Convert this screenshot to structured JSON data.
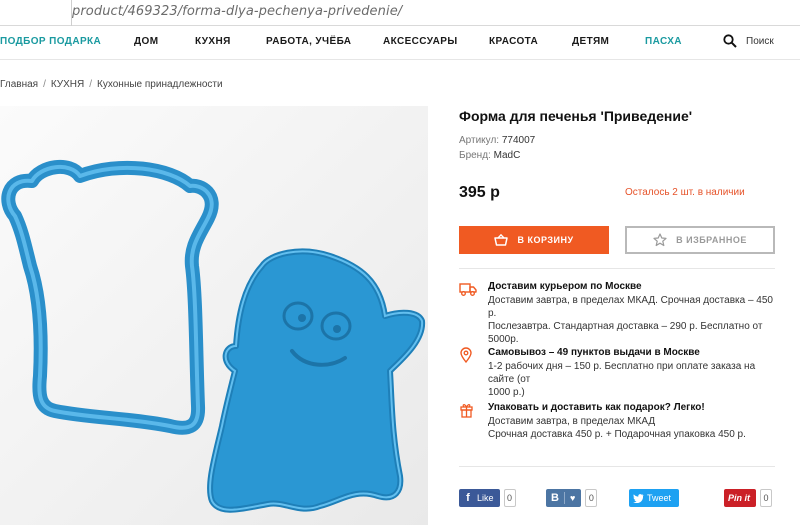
{
  "browser": {
    "url": "product/469323/forma-dlya-pechenya-privedenie/"
  },
  "nav": {
    "items": [
      {
        "label": "ПОДБОР ПОДАРКА",
        "accent": true
      },
      {
        "label": "ДОМ"
      },
      {
        "label": "КУХНЯ"
      },
      {
        "label": "РАБОТА, УЧЁБА"
      },
      {
        "label": "АКСЕССУАРЫ"
      },
      {
        "label": "КРАСОТА"
      },
      {
        "label": "ДЕТЯМ"
      },
      {
        "label": "ПАСХА",
        "accent": true
      }
    ],
    "search_label": "Поиск"
  },
  "breadcrumb": [
    "Главная",
    "КУХНЯ",
    "Кухонные принадлежности"
  ],
  "product": {
    "title": "Форма для печенья 'Приведение'",
    "article_label": "Артикул:",
    "article_value": "774007",
    "brand_label": "Бренд:",
    "brand_value": "MadC",
    "price": "395 р",
    "stock": "Осталось 2 шт. в наличии",
    "image_alt": "ghost and bread shaped blue cookie cutters"
  },
  "buttons": {
    "cart": "В КОРЗИНУ",
    "favorite": "В ИЗБРАННОЕ"
  },
  "delivery": [
    {
      "icon": "truck-icon",
      "title": "Доставим курьером по Москве",
      "lines": [
        "Доставим завтра, в пределах МКАД. Срочная доставка – 450 р.",
        "Послезавтра. Стандартная доставка – 290 р. Бесплатно от",
        "5000р."
      ]
    },
    {
      "icon": "location-pin-icon",
      "title": "Самовывоз – 49 пунктов выдачи в Москве",
      "lines": [
        "1-2 рабочих дня – 150 р. Бесплатно при оплате заказа на сайте (от",
        "1000 р.)"
      ]
    },
    {
      "icon": "gift-icon",
      "title": "Упаковать и доставить как подарок? Легко!",
      "lines": [
        "Доставим завтра, в пределах МКАД",
        "Срочная доставка 450 р. + Подарочная упаковка 450 р."
      ]
    }
  ],
  "social": {
    "facebook": {
      "label": "Like",
      "count": "0",
      "color": "#3b5998"
    },
    "vk": {
      "label": "♥",
      "count": "0",
      "color": "#4c75a3"
    },
    "twitter": {
      "label": "Tweet",
      "count": "0",
      "color": "#1da1f2"
    },
    "pinterest": {
      "label": "Pin it",
      "count": "0",
      "color": "#cb2027"
    }
  },
  "colors": {
    "accent": "#1a9aa0",
    "cta": "#f05a22",
    "stock": "#e6532a",
    "cutter": "#2a97d3"
  }
}
